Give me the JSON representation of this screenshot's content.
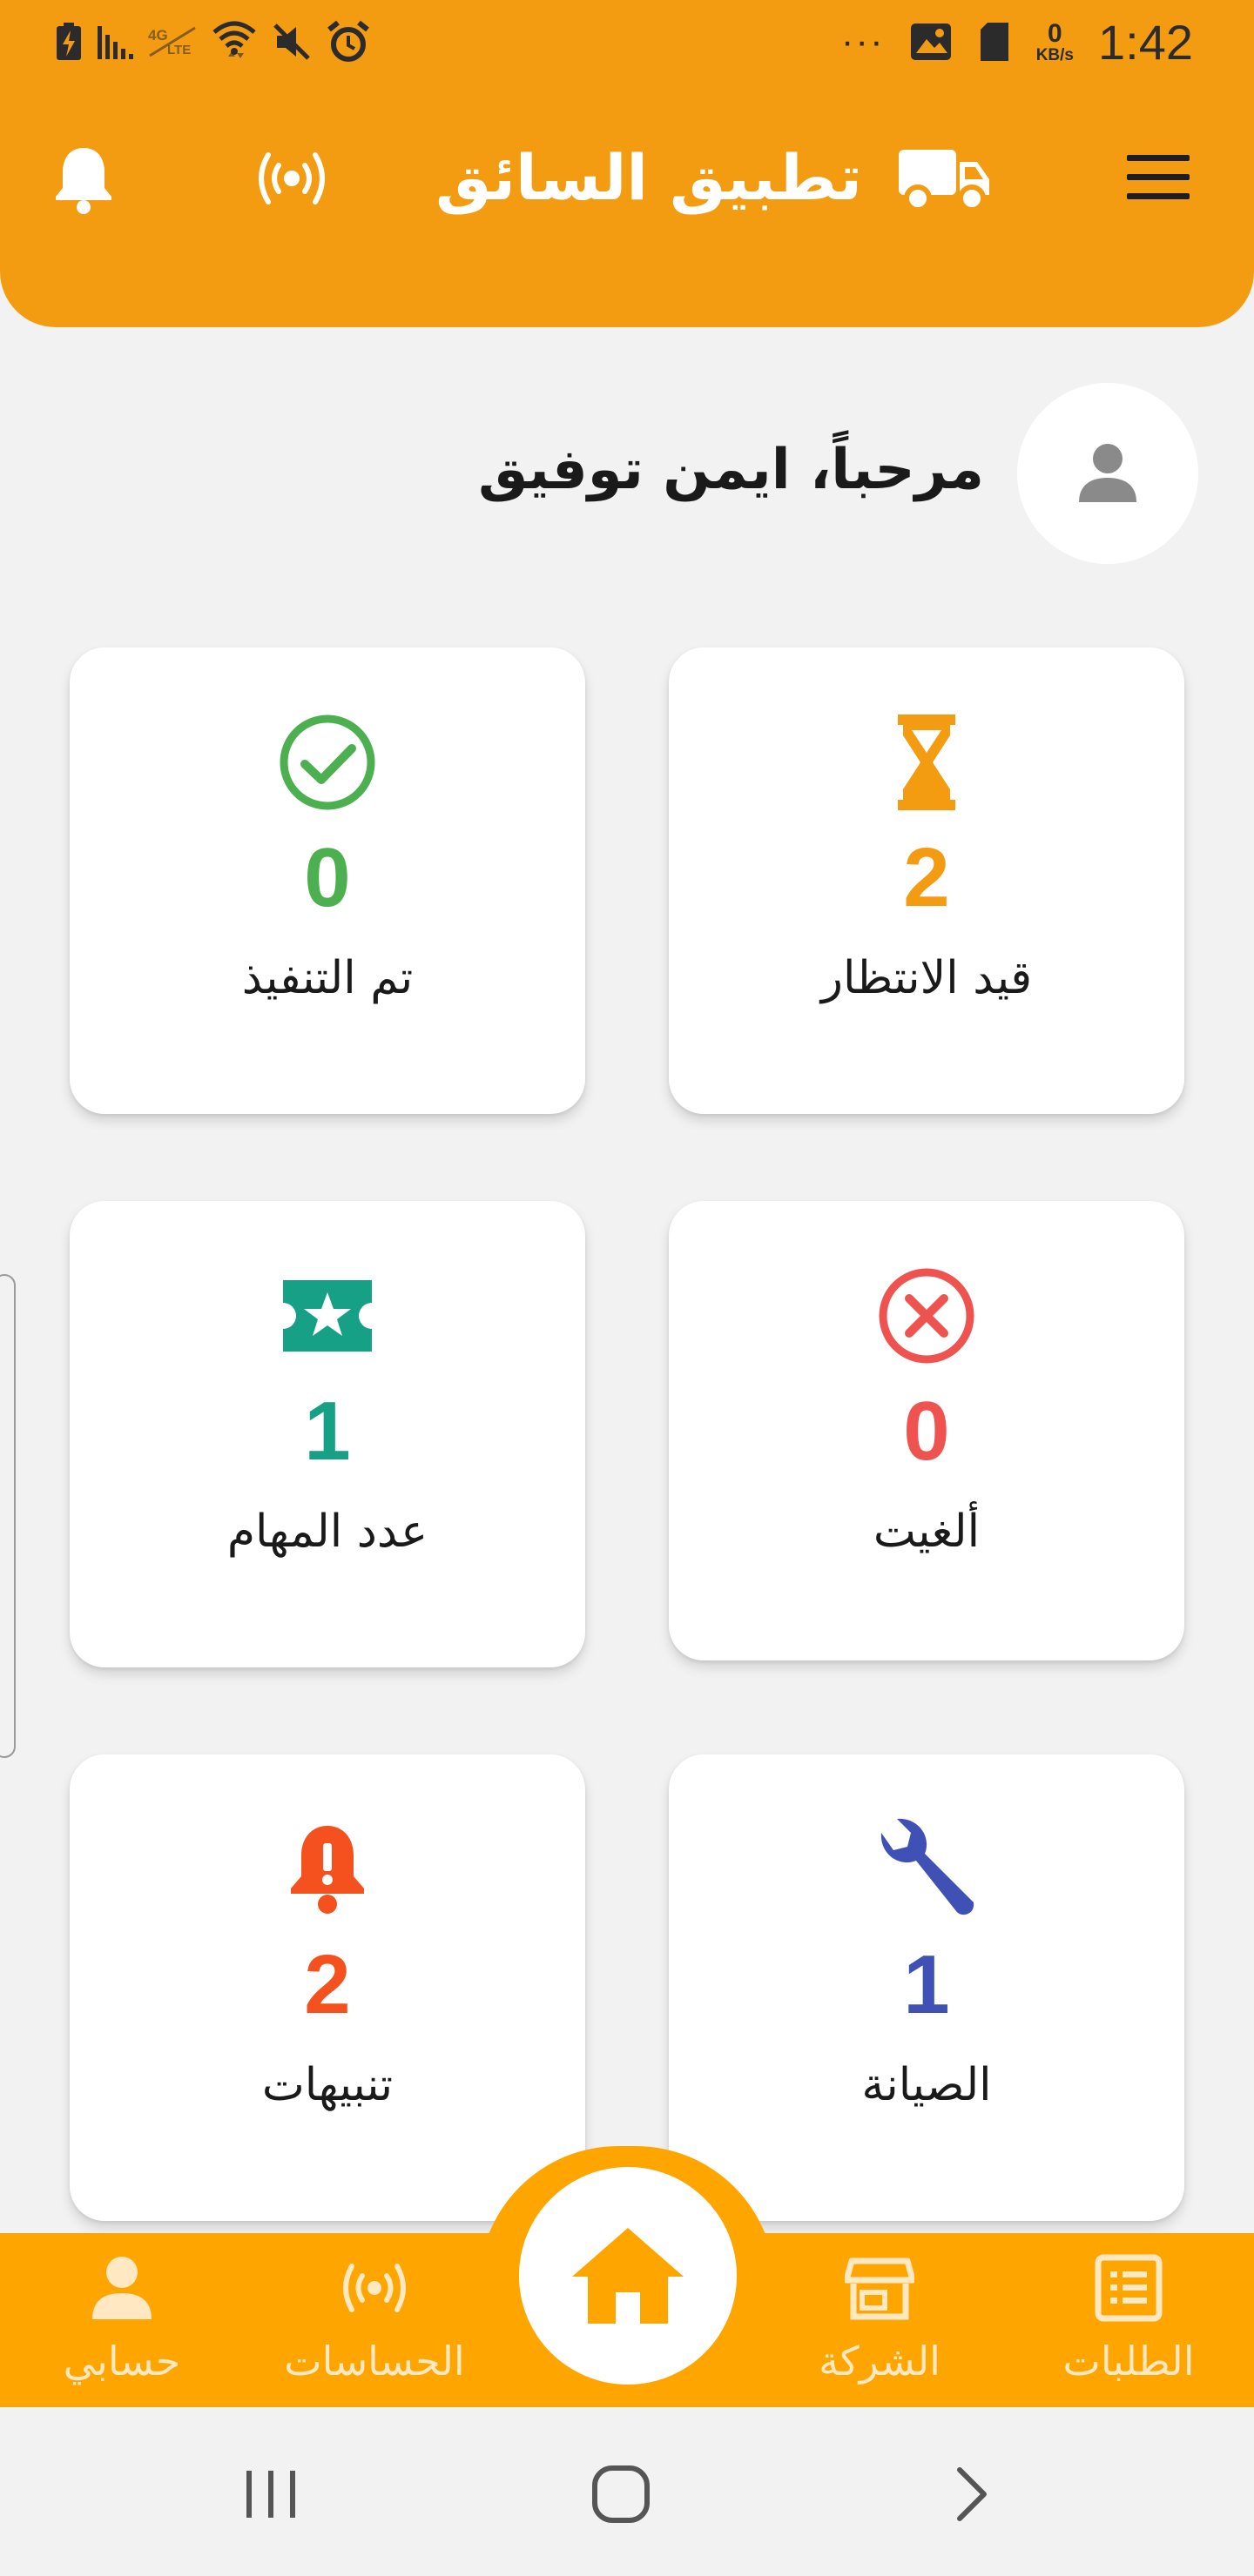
{
  "status_bar": {
    "time": "1:42",
    "more": "···",
    "net_speed_value": "0",
    "net_speed_unit": "KB/s",
    "icons": [
      "battery-charging-icon",
      "signal-icon",
      "volte-icon",
      "wifi-icon",
      "mute-icon",
      "alarm-icon",
      "image-icon",
      "sim-card-icon"
    ]
  },
  "app_bar": {
    "title": "تطبيق السائق",
    "icons": [
      "menu-icon",
      "truck-icon",
      "sensor-icon",
      "bell-icon"
    ]
  },
  "greeting": {
    "text": "مرحباً، ايمن توفيق",
    "avatar_icon": "person-icon"
  },
  "cards": {
    "pending": {
      "count": "2",
      "label": "قيد الانتظار",
      "icon": "hourglass-icon",
      "color": "#f39c12"
    },
    "completed": {
      "count": "0",
      "label": "تم التنفيذ",
      "icon": "check-circle-icon",
      "color": "#4caf50"
    },
    "cancelled": {
      "count": "0",
      "label": "ألغيت",
      "icon": "cancel-circle-icon",
      "color": "#ef5350"
    },
    "tasks": {
      "count": "1",
      "label": "عدد المهام",
      "icon": "ticket-star-icon",
      "color": "#16a085"
    },
    "maintenance": {
      "count": "1",
      "label": "الصيانة",
      "icon": "wrench-icon",
      "color": "#3f51b5"
    },
    "alerts": {
      "count": "2",
      "label": "تنبيهات",
      "icon": "bell-alert-icon",
      "color": "#f4511e"
    }
  },
  "bottom_nav": {
    "orders": {
      "label": "الطلبات",
      "icon": "receipt-icon"
    },
    "company": {
      "label": "الشركة",
      "icon": "store-icon"
    },
    "home": {
      "icon": "home-icon"
    },
    "sensors": {
      "label": "الحساسات",
      "icon": "sensor-icon"
    },
    "account": {
      "label": "حسابي",
      "icon": "person-icon"
    }
  },
  "system_nav": {
    "icons": [
      "recents-icon",
      "home-outline-icon",
      "back-icon"
    ]
  },
  "colors": {
    "primary": "#f39c12",
    "nav_background": "#ffa500",
    "background": "#f2f2f2",
    "card": "#ffffff"
  }
}
